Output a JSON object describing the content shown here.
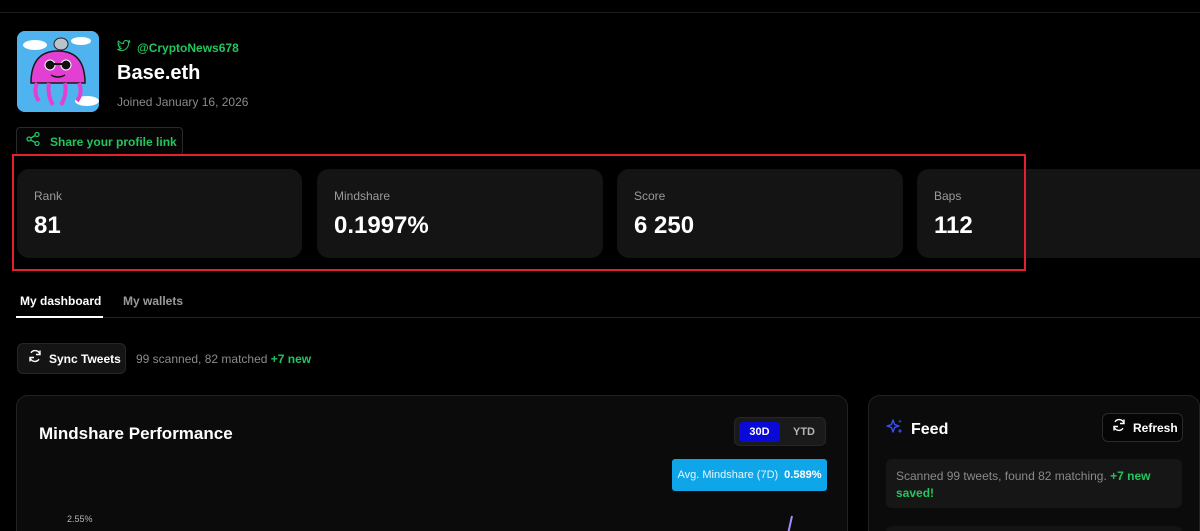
{
  "profile": {
    "twitter_handle": "@CryptoNews678",
    "name": "Base.eth",
    "joined": "Joined January 16, 2026",
    "share_label": "Share your profile link",
    "avatar_icon": "jellyfish-avatar"
  },
  "stats": [
    {
      "label": "Rank",
      "value": "81"
    },
    {
      "label": "Mindshare",
      "value": "0.1997%"
    },
    {
      "label": "Score",
      "value": "6 250"
    },
    {
      "label": "Baps",
      "value": "112"
    }
  ],
  "tabs": [
    {
      "label": "My dashboard",
      "active": true
    },
    {
      "label": "My wallets",
      "active": false
    }
  ],
  "sync": {
    "button_label": "Sync Tweets",
    "status": "99 scanned, 82 matched",
    "new": "+7 new"
  },
  "mindshare_panel": {
    "title": "Mindshare Performance",
    "ranges": [
      "30D",
      "YTD"
    ],
    "selected_range": "30D",
    "avg_label": "Avg. Mindshare (7D)",
    "avg_value": "0.589%",
    "y_tick": "2.55%"
  },
  "feed": {
    "title": "Feed",
    "refresh_label": "Refresh",
    "message": "Scanned 99 tweets, found 82 matching.",
    "message_new": "+7 new saved!"
  },
  "colors": {
    "accent_green": "#22c55e",
    "highlight_red": "#e2202f",
    "toggle_blue": "#0a0ad6",
    "badge_blue": "#0ea5e9",
    "chart_line": "#a78bfa"
  }
}
